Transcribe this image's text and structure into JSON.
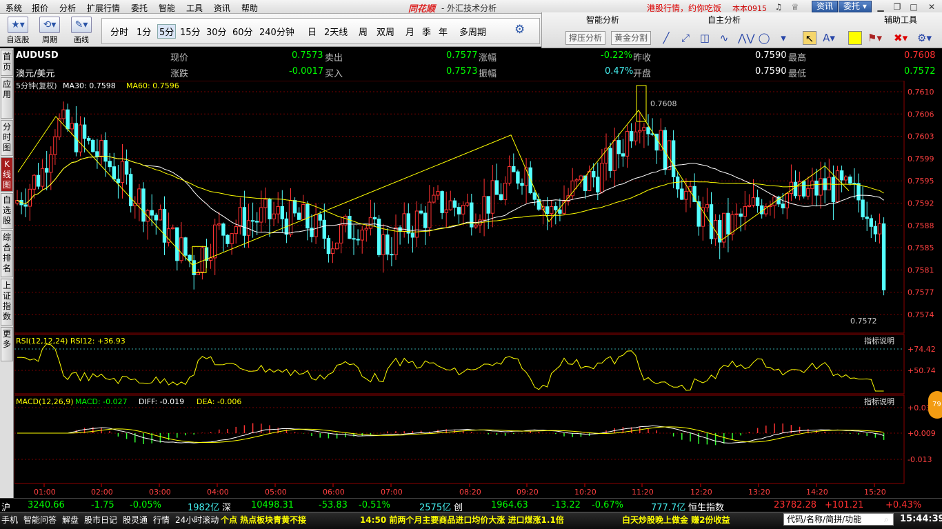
{
  "menu": [
    "系统",
    "报价",
    "分析",
    "扩展行情",
    "委托",
    "智能",
    "工具",
    "资讯",
    "帮助"
  ],
  "brand": "同花顺",
  "window_title": "- 外汇技术分析",
  "promo": "港股行情，约你吃饭",
  "build": "本本0915",
  "top_buttons": [
    "资讯",
    "委托"
  ],
  "toolbar_big": [
    {
      "icon": "star",
      "label": "自选股"
    },
    {
      "icon": "cycle",
      "label": "周期"
    },
    {
      "icon": "pen",
      "label": "画线"
    }
  ],
  "periods": [
    "分时",
    "1分",
    "5分",
    "15分",
    "30分",
    "60分",
    "240分钟",
    "日",
    "2天线",
    "周",
    "双周",
    "月",
    "季",
    "年",
    "多周期"
  ],
  "active_period": "5分",
  "panel_titles": [
    "智能分析",
    "自主分析",
    "辅助工具"
  ],
  "smart_buttons": [
    "撑压分析",
    "黄金分割"
  ],
  "left_tabs": [
    "首页",
    "应用",
    "分时图",
    "K线图",
    "自选股",
    "综合排名",
    "上证指数",
    "更多"
  ],
  "quote": {
    "symbol": "AUDUSD",
    "name": "澳元/美元",
    "fields": [
      {
        "label": "现价",
        "value": "0.7573",
        "color": "g"
      },
      {
        "label": "卖出",
        "value": "0.7577",
        "color": "g"
      },
      {
        "label": "涨幅",
        "value": "-0.22%",
        "color": "g"
      },
      {
        "label": "昨收",
        "value": "0.7590",
        "color": "w"
      },
      {
        "label": "最高",
        "value": "0.7608",
        "color": "r"
      },
      {
        "label": "涨跌",
        "value": "-0.0017",
        "color": "g"
      },
      {
        "label": "买入",
        "value": "0.7573",
        "color": "g"
      },
      {
        "label": "振幅",
        "value": "0.47%",
        "color": "c"
      },
      {
        "label": "开盘",
        "value": "0.7590",
        "color": "w"
      },
      {
        "label": "最低",
        "value": "0.7572",
        "color": "g"
      }
    ]
  },
  "indicator_header": {
    "period": "5分钟(复权)",
    "ma30": "MA30: 0.7598",
    "ma60": "MA60: 0.7596"
  },
  "rsi_header": "RSI(12,12,24) RSI12: +36.93",
  "macd_header": {
    "name": "MACD(12,26,9)",
    "macd": "MACD: -0.027",
    "diff": "DIFF: -0.019",
    "dea": "DEA: -0.006"
  },
  "help_label": "指标说明",
  "badge": "79",
  "chart_data": {
    "type": "candlestick",
    "price_axis": [
      "0.7610",
      "0.7606",
      "0.7603",
      "0.7599",
      "0.7595",
      "0.7592",
      "0.7588",
      "0.7585",
      "0.7581",
      "0.7577",
      "0.7574"
    ],
    "rsi_axis": [
      "+74.42",
      "+50.74"
    ],
    "macd_axis": [
      "+0.031",
      "+0.009",
      "-0.013"
    ],
    "time_axis": [
      "01:00",
      "02:00",
      "03:00",
      "04:00",
      "05:00",
      "06:00",
      "07:00",
      "08:20",
      "09:20",
      "10:20",
      "11:20",
      "12:20",
      "13:20",
      "14:20",
      "15:20"
    ],
    "annotations": {
      "high": "0.7608",
      "low": "0.7572"
    },
    "ylim": [
      0.7572,
      0.7611
    ]
  },
  "bottom_indices": [
    {
      "name": "沪",
      "items": [
        {
          "t": "3240.66",
          "c": "g"
        },
        {
          "t": "-1.75",
          "c": "g"
        },
        {
          "t": "-0.05%",
          "c": "g"
        },
        {
          "t": "1982亿",
          "c": "c"
        }
      ]
    },
    {
      "name": "深",
      "items": [
        {
          "t": "10498.31",
          "c": "g"
        },
        {
          "t": "-53.83",
          "c": "g"
        },
        {
          "t": "-0.51%",
          "c": "g"
        },
        {
          "t": "2575亿",
          "c": "c"
        }
      ]
    },
    {
      "name": "创",
      "items": [
        {
          "t": "1964.63",
          "c": "g"
        },
        {
          "t": "-13.22",
          "c": "g"
        },
        {
          "t": "-0.67%",
          "c": "g"
        },
        {
          "t": "777.7亿",
          "c": "c"
        }
      ]
    },
    {
      "name": "恒生指数",
      "items": [
        {
          "t": "23782.28",
          "c": "r"
        },
        {
          "t": "+101.21",
          "c": "r"
        },
        {
          "t": "+0.43%",
          "c": "r"
        }
      ]
    }
  ],
  "status_tabs": [
    "手机",
    "智能问答",
    "解盘",
    "股市日记",
    "股灵通",
    "行情",
    "24小时滚动"
  ],
  "news": [
    "个点 热点板块青黄不接",
    "14:50 前两个月主要商品进口均价大涨 进口煤涨1.1倍",
    "白天炒股晚上做金 赚2份收益"
  ],
  "code_box": "代码/名称/简拼/功能",
  "clock": "15:44:39"
}
